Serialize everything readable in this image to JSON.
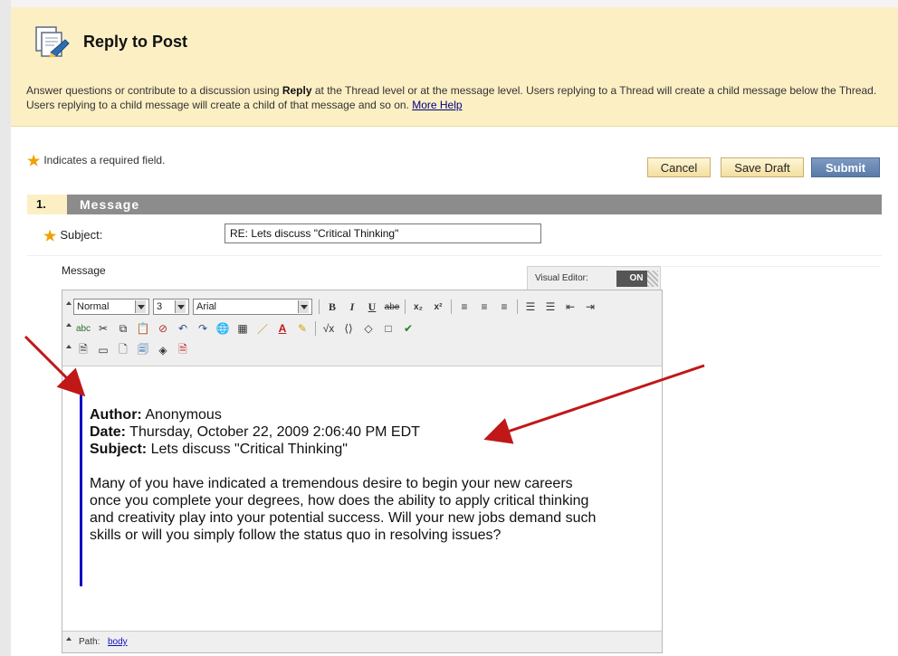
{
  "header": {
    "title": "Reply to Post",
    "intro_before": "Answer questions or contribute to a discussion using ",
    "intro_bold": "Reply",
    "intro_after": " at the Thread level or at the message level. Users replying to a Thread will create a child message below the Thread. Users replying to a child message will create a child of that message and so on. ",
    "more_help": "More Help",
    "background": "#fcefc4"
  },
  "required_note": "Indicates a required field.",
  "actions": {
    "cancel": "Cancel",
    "save_draft": "Save Draft",
    "submit": "Submit"
  },
  "section": {
    "number": "1.",
    "title": "Message"
  },
  "form": {
    "subject_label": "Subject:",
    "subject_value": "RE: Lets discuss \"Critical Thinking\"",
    "message_label": "Message"
  },
  "visual_editor": {
    "label": "Visual Editor:",
    "state": "ON"
  },
  "toolbar": {
    "format_value": "Normal",
    "size_value": "3",
    "font_value": "Arial",
    "row1_icons": [
      "bold-icon",
      "italic-icon",
      "underline-icon",
      "strikethrough-icon",
      "subscript-icon",
      "superscript-icon",
      "align-left-icon",
      "align-center-icon",
      "align-right-icon",
      "ordered-list-icon",
      "unordered-list-icon",
      "outdent-icon",
      "indent-icon"
    ],
    "row2_icons": [
      "spellcheck-icon",
      "cut-icon",
      "copy-icon",
      "paste-icon",
      "unlink-icon",
      "undo-icon",
      "redo-icon",
      "link-icon",
      "table-icon",
      "line-icon",
      "text-color-icon",
      "highlight-icon",
      "math-icon",
      "html-icon",
      "code-icon",
      "preview-icon",
      "check-icon"
    ],
    "row3_icons": [
      "paste-text-icon",
      "image-icon",
      "media-icon",
      "insert-file-icon",
      "attachment-icon",
      "pdf-icon"
    ]
  },
  "quote": {
    "author_label": "Author:",
    "author": " Anonymous",
    "date_label": "Date:",
    "date": " Thursday, October 22, 2009 2:06:40 PM EDT",
    "subject_label": "Subject:",
    "subject": " Lets discuss \"Critical Thinking\"",
    "body": "Many of you have indicated a tremendous desire to begin your new careers once you complete your degrees, how does the ability to apply critical thinking and creativity play into your potential success. Will your new jobs demand such skills or will you simply follow the status quo in resolving issues?"
  },
  "pathbar": {
    "label": "Path:",
    "link": "body"
  },
  "colors": {
    "accent": "#5a7aa8",
    "section_bar": "#8c8c8c",
    "quote_bar": "#1010c0",
    "annotation_arrow": "#c01818",
    "required_star": "#f0a000"
  }
}
